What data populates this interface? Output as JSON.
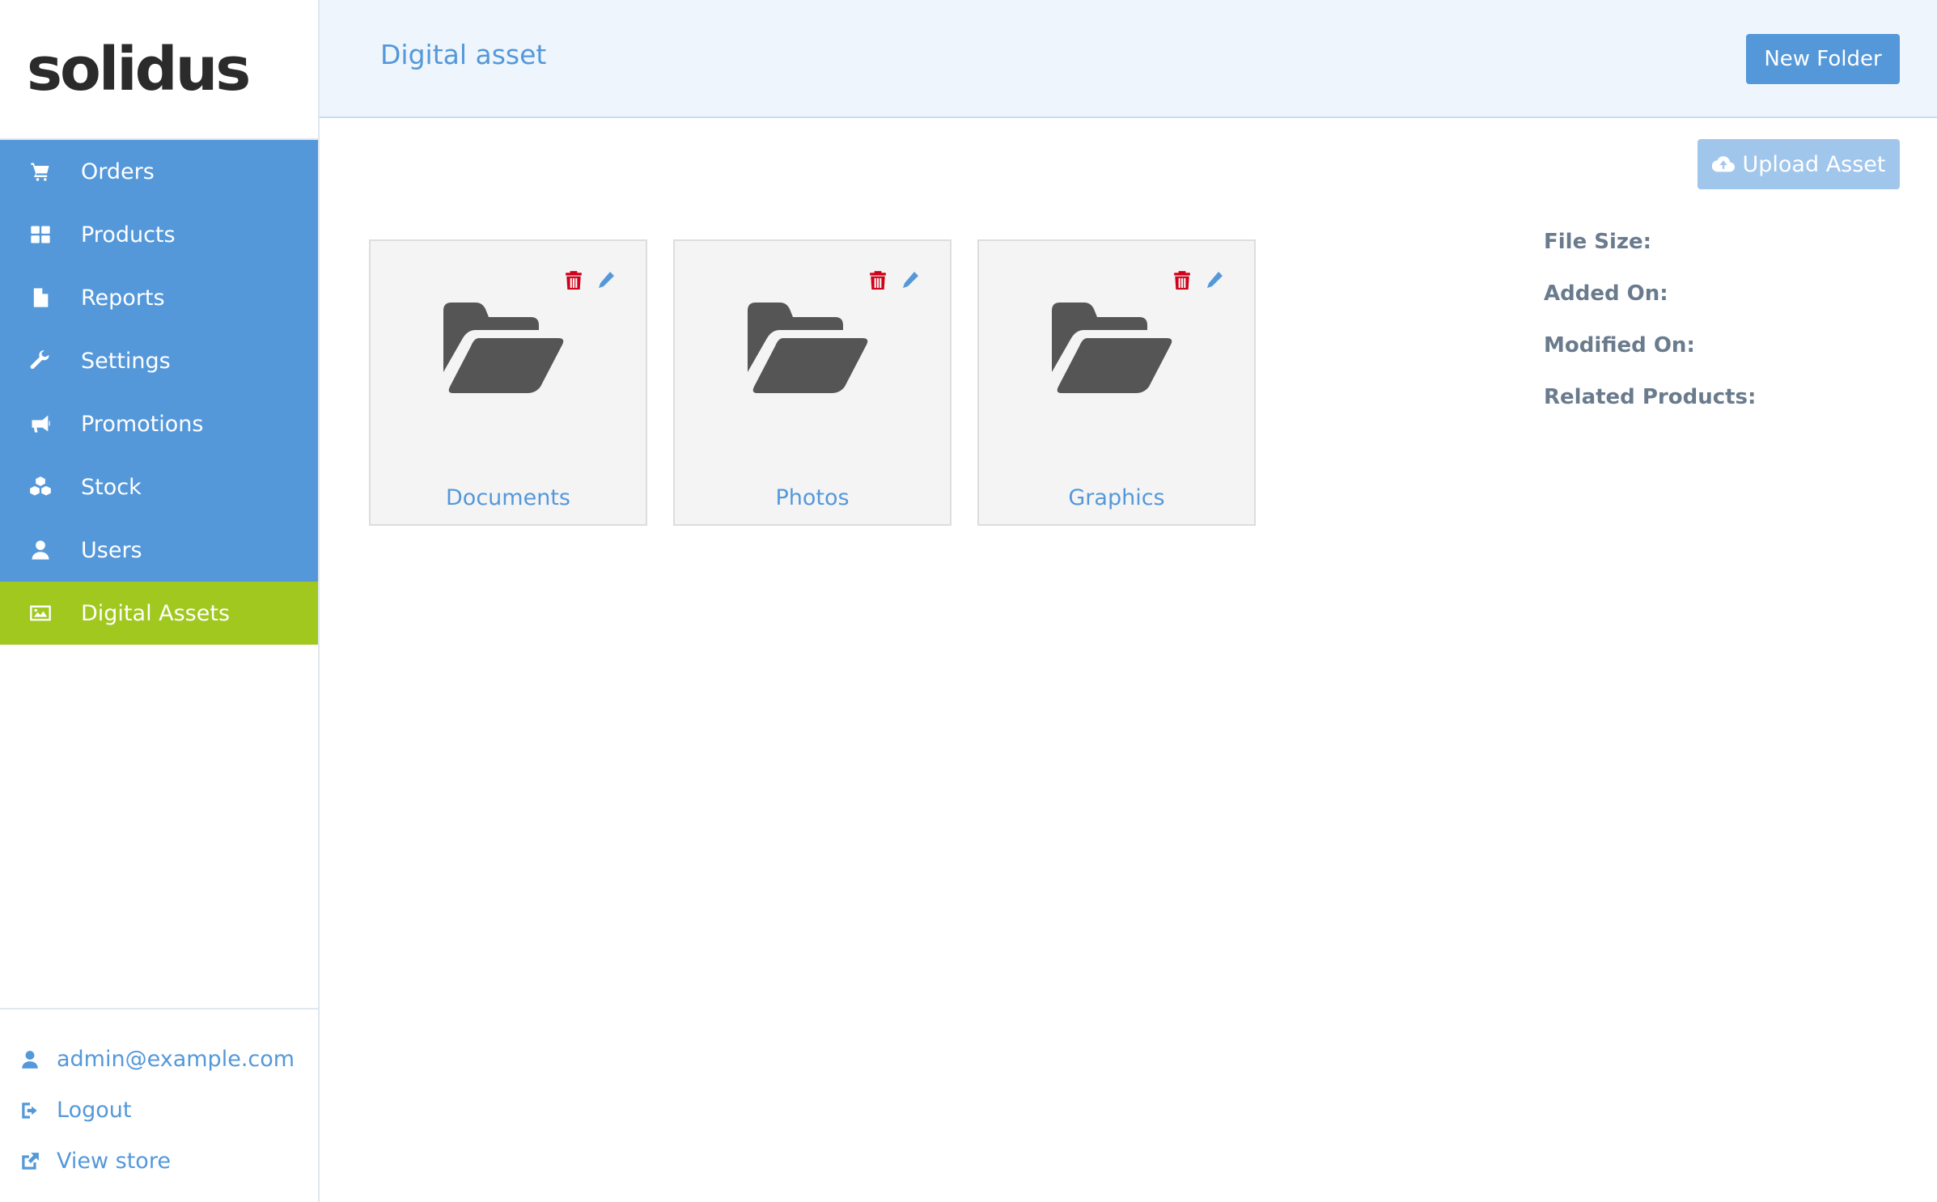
{
  "logo": {
    "text": "solidus"
  },
  "sidebar": {
    "items": [
      {
        "label": "Orders",
        "icon": "cart-icon",
        "active": false
      },
      {
        "label": "Products",
        "icon": "th-large-icon",
        "active": false
      },
      {
        "label": "Reports",
        "icon": "file-icon",
        "active": false
      },
      {
        "label": "Settings",
        "icon": "wrench-icon",
        "active": false
      },
      {
        "label": "Promotions",
        "icon": "bullhorn-icon",
        "active": false
      },
      {
        "label": "Stock",
        "icon": "cubes-icon",
        "active": false
      },
      {
        "label": "Users",
        "icon": "user-icon",
        "active": false
      },
      {
        "label": "Digital Assets",
        "icon": "image-icon",
        "active": true
      }
    ],
    "footer": {
      "user_email": "admin@example.com",
      "logout": "Logout",
      "view_store": "View store"
    }
  },
  "header": {
    "title": "Digital asset",
    "new_folder_label": "New Folder"
  },
  "main": {
    "upload_label": "Upload Asset",
    "folders": [
      {
        "name": "Documents"
      },
      {
        "name": "Photos"
      },
      {
        "name": "Graphics"
      }
    ],
    "details": {
      "file_size": "File Size:",
      "added_on": "Added On:",
      "modified_on": "Modified On:",
      "related_products": "Related Products:"
    }
  },
  "colors": {
    "primary": "#5498da",
    "active": "#a0c81f",
    "danger": "#d0021b",
    "header_bg": "#eef5fc",
    "upload_disabled": "#a1c6ec"
  }
}
